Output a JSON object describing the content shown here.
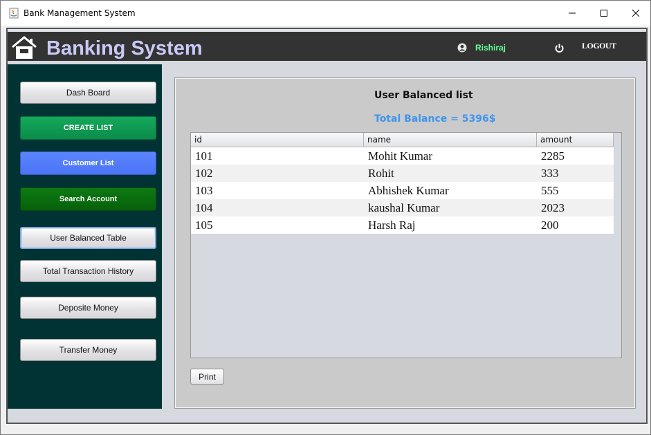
{
  "window": {
    "title": "Bank Management System"
  },
  "header": {
    "brand": "Banking System",
    "username": "Rishiraj",
    "logout_label": "LOGOUT"
  },
  "sidebar": {
    "items": [
      {
        "label": "Dash Board"
      },
      {
        "label": "CREATE LIST"
      },
      {
        "label": "Customer List"
      },
      {
        "label": "Search Account"
      },
      {
        "label": "User Balanced Table"
      },
      {
        "label": "Total Transaction History"
      },
      {
        "label": "Deposite Money"
      },
      {
        "label": "Transfer Money"
      }
    ]
  },
  "main": {
    "title": "User Balanced list",
    "total_balance": "Total Balance = 5396$",
    "table": {
      "columns": [
        "id",
        "name",
        "amount"
      ],
      "rows": [
        [
          "101",
          "Mohit Kumar",
          "2285"
        ],
        [
          "102",
          "Rohit",
          "333"
        ],
        [
          "103",
          "Abhishek Kumar",
          "555"
        ],
        [
          "104",
          "kaushal Kumar",
          "2023"
        ],
        [
          "105",
          "Harsh Raj",
          "200"
        ]
      ]
    },
    "print_label": "Print"
  },
  "colors": {
    "header_bg": "#333333",
    "sidebar_bg": "#013334",
    "brand_text": "#c9c9f7",
    "username_text": "#66ff99",
    "total_balance_text": "#3e95ee",
    "create_list_btn": "#0b8d4a",
    "customer_list_btn": "#4a74f5",
    "search_account_btn": "#06600b"
  }
}
